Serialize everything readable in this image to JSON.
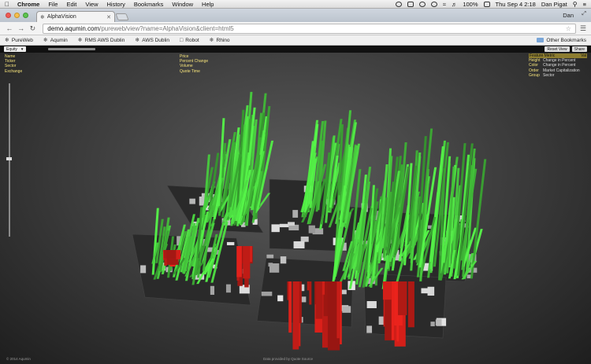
{
  "menubar": {
    "items": [
      "Chrome",
      "File",
      "Edit",
      "View",
      "History",
      "Bookmarks",
      "Window",
      "Help"
    ],
    "battery": "100%",
    "clock": "Thu Sep 4  2:18",
    "user": "Dan Pigat"
  },
  "browser": {
    "tab_title": "AlphaVision",
    "profile_name": "Dan",
    "url_host": "demo.aqumin.com",
    "url_path": "/pureweb/view?name=AlphaVision&client=html5",
    "bookmarks": [
      "PureWeb",
      "Aqumin",
      "RMS AWS Dublin",
      "AWS Dublin",
      "Robot",
      "Rhino"
    ],
    "other_bookmarks": "Other Bookmarks"
  },
  "app": {
    "asset_select": "Equity",
    "buttons": {
      "reset": "Reset View",
      "share": "Share"
    },
    "info_left": [
      "Name",
      "Ticker",
      "Sector",
      "Exchange"
    ],
    "info_mid": [
      "Price",
      "Percent Change",
      "Volume",
      "Quote Time"
    ],
    "legend": {
      "header": [
        "Feature",
        "Metric",
        "Val"
      ],
      "rows": [
        {
          "k": "Height",
          "v": "Change in Percent"
        },
        {
          "k": "Color",
          "v": "Change in Percent"
        },
        {
          "k": "Order",
          "v": "Market Capitalization"
        },
        {
          "k": "Group",
          "v": "Sector"
        }
      ]
    },
    "zoom_level": 0.48,
    "credit_left": "© 2014 Aqumin",
    "credit_mid": "Data provided by Quote Source",
    "colors": {
      "up": "#3fd43a",
      "down": "#d8231f",
      "tile": "#2a2a2a"
    }
  }
}
